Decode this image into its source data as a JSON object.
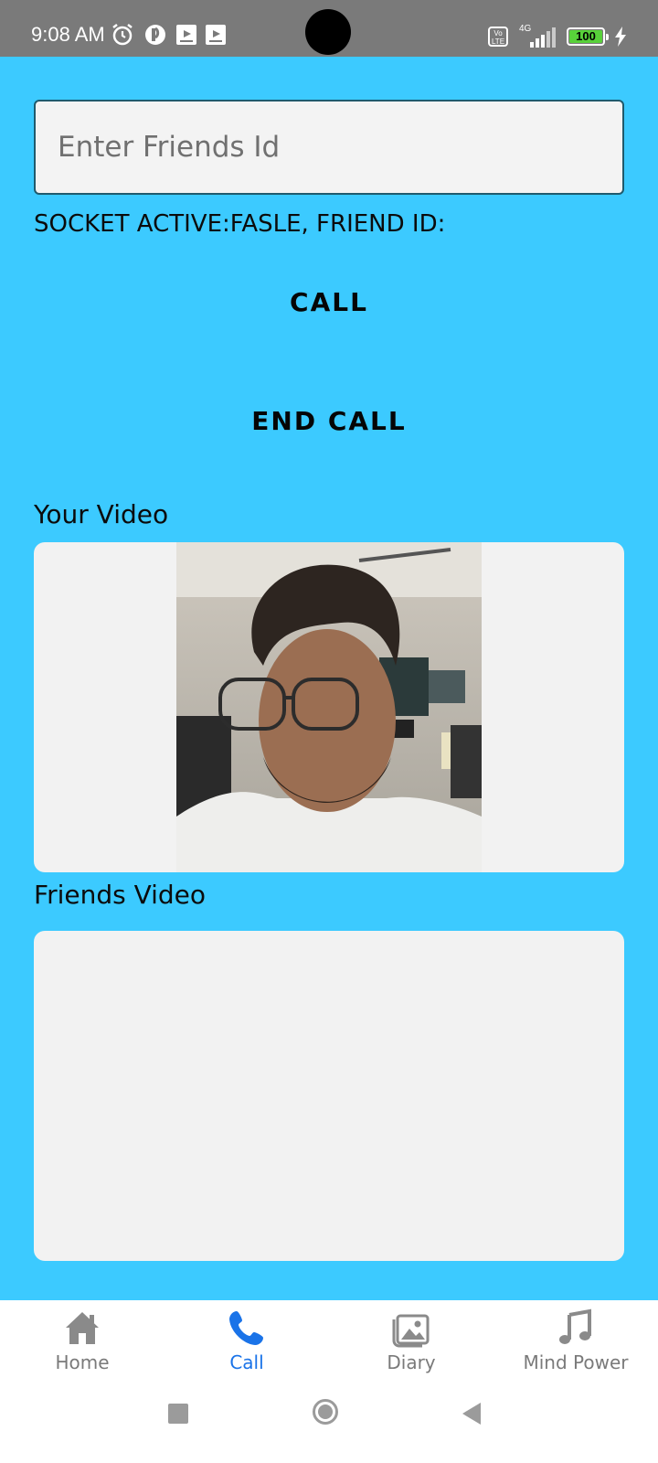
{
  "status_bar": {
    "time": "9:08 AM",
    "battery_text": "100",
    "network": "4G",
    "volte_top": "Vo",
    "volte_bottom": "LTE",
    "icons": [
      "alarm-icon",
      "app-notification-icon",
      "video-notification-icon",
      "video-notification-icon",
      "volte-icon",
      "signal-icon",
      "battery-icon",
      "charging-icon"
    ]
  },
  "main": {
    "background": "#3ccaff",
    "friend_input": {
      "placeholder": "Enter Friends Id",
      "value": ""
    },
    "socket_status": "SOCKET ACTIVE:FASLE, FRIEND ID:",
    "call_label": "CALL",
    "end_call_label": "END CALL",
    "your_video_label": "Your Video",
    "friends_video_label": "Friends Video"
  },
  "bottom_nav": {
    "active": "Call",
    "active_color": "#1a73e8",
    "items": [
      {
        "label": "Home",
        "icon": "home-icon"
      },
      {
        "label": "Call",
        "icon": "phone-icon"
      },
      {
        "label": "Diary",
        "icon": "image-icon"
      },
      {
        "label": "Mind Power",
        "icon": "music-note-icon"
      }
    ]
  },
  "system_nav": {
    "buttons": [
      "recent-apps-icon",
      "home-circle-icon",
      "back-icon"
    ]
  }
}
